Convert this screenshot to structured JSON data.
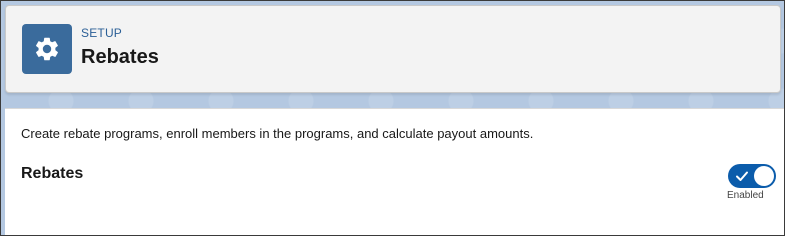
{
  "header": {
    "icon": "gear-icon",
    "eyebrow": "SETUP",
    "title": "Rebates"
  },
  "main": {
    "description": "Create rebate programs, enroll members in the programs, and calculate payout amounts.",
    "setting": {
      "label": "Rebates",
      "toggle_state_label": "Enabled",
      "toggle_on": true,
      "toggle_icon": "checkmark-icon"
    }
  },
  "colors": {
    "icon_bg": "#3a6b9c",
    "toggle_on": "#0b5cab",
    "eyebrow_text": "#2b5f96"
  }
}
